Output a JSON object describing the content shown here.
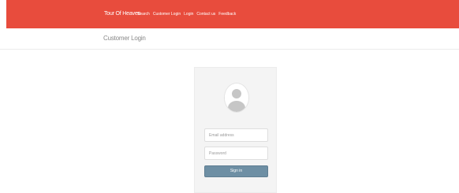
{
  "nav": {
    "brand": "Tour Of Heaven",
    "links": [
      "Search",
      "Customer Login",
      "Login",
      "Contact us",
      "Feedback"
    ]
  },
  "header": {
    "title": "Customer Login"
  },
  "login": {
    "email_placeholder": "Email address",
    "password_placeholder": "Password",
    "signin_label": "Sign in",
    "avatar_icon": "user-icon"
  },
  "colors": {
    "navbar": "#e84c3d",
    "button": "#6e8fa4",
    "card": "#f4f4f4"
  }
}
